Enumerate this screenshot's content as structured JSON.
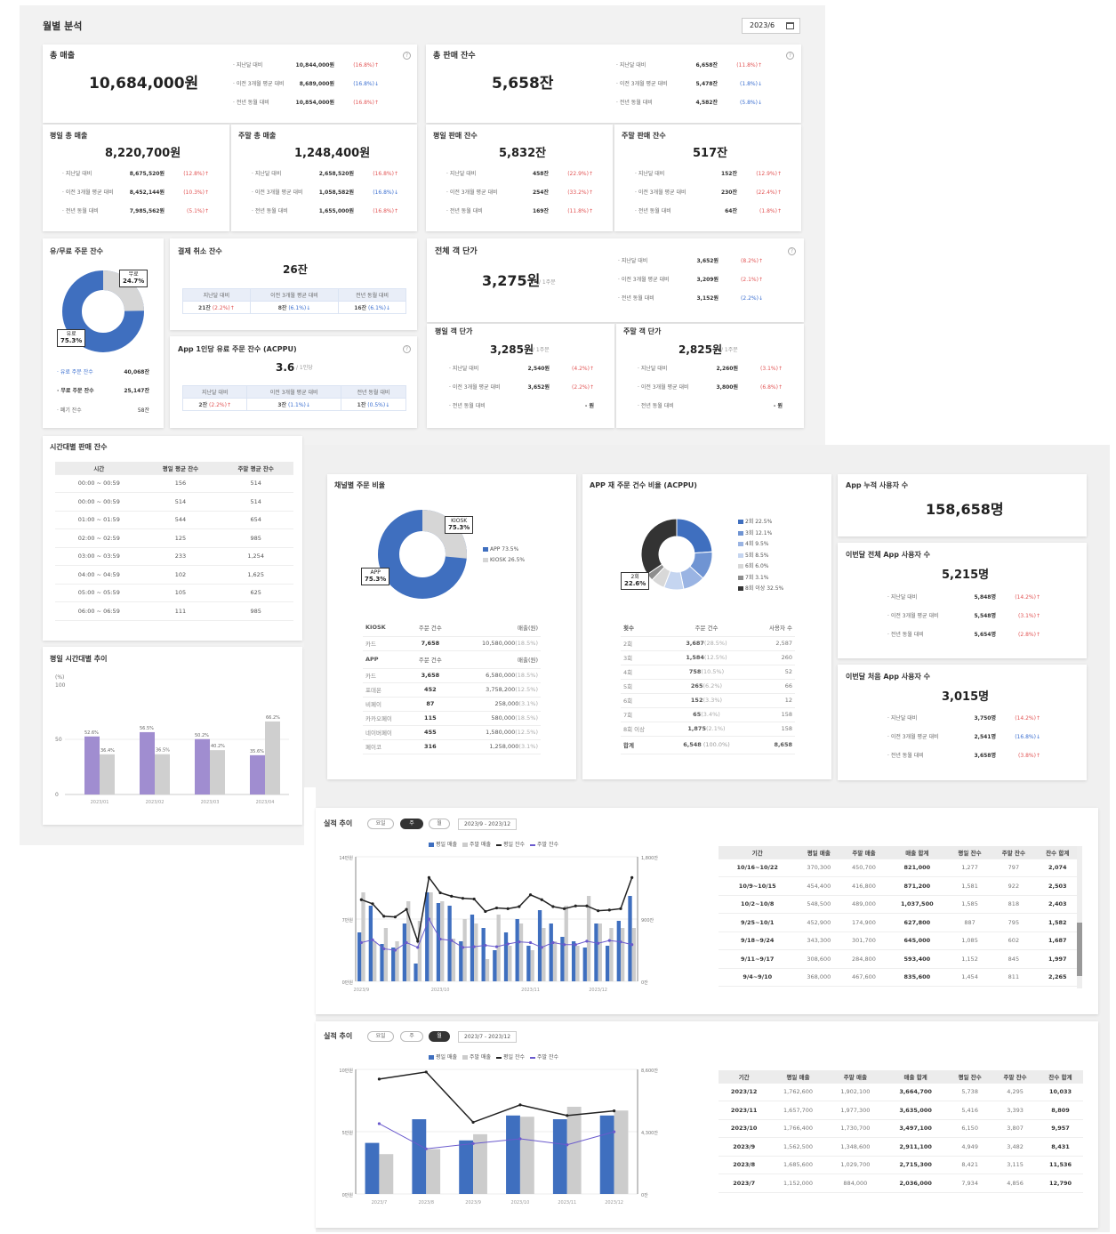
{
  "header": {
    "title": "월별 분석",
    "month": "2023/6"
  },
  "revenue": {
    "title": "총 매출",
    "value": "10,684,000원",
    "compare": [
      {
        "label": "· 지난달 대비",
        "value": "10,844,000원",
        "pct": "(16.8%)↑",
        "dir": "up"
      },
      {
        "label": "· 이전 3개월 평균 대비",
        "value": "8,689,000원",
        "pct": "(16.8%)↓",
        "dir": "down"
      },
      {
        "label": "· 전년 동월 대비",
        "value": "10,854,000원",
        "pct": "(16.8%)↑",
        "dir": "up"
      }
    ],
    "weekday": {
      "title": "평일 총 매출",
      "value": "8,220,700원",
      "compare": [
        {
          "label": "· 지난달 대비",
          "value": "8,675,520원",
          "pct": "(12.8%)↑",
          "dir": "up"
        },
        {
          "label": "· 이전 3개월 평균 대비",
          "value": "8,452,144원",
          "pct": "(10.3%)↑",
          "dir": "up"
        },
        {
          "label": "· 전년 동월 대비",
          "value": "7,985,562원",
          "pct": "(5.1%)↑",
          "dir": "up"
        }
      ]
    },
    "weekend": {
      "title": "주말 총 매출",
      "value": "1,248,400원",
      "compare": [
        {
          "label": "· 지난달 대비",
          "value": "2,658,520원",
          "pct": "(16.8%)↑",
          "dir": "up"
        },
        {
          "label": "· 이전 3개월 평균 대비",
          "value": "1,058,582원",
          "pct": "(16.8%)↓",
          "dir": "down"
        },
        {
          "label": "· 전년 동월 대비",
          "value": "1,655,000원",
          "pct": "(16.8%)↑",
          "dir": "up"
        }
      ]
    }
  },
  "sales": {
    "title": "총 판매 잔수",
    "value": "5,658잔",
    "compare": [
      {
        "label": "· 지난달 대비",
        "value": "6,658잔",
        "pct": "(11.8%)↑",
        "dir": "up"
      },
      {
        "label": "· 이전 3개월 평균 대비",
        "value": "5,478잔",
        "pct": "(1.8%)↓",
        "dir": "down"
      },
      {
        "label": "· 전년 동월 대비",
        "value": "4,582잔",
        "pct": "(5.8%)↓",
        "dir": "down"
      }
    ],
    "weekday": {
      "title": "평일 판매 잔수",
      "value": "5,832잔",
      "compare": [
        {
          "label": "· 지난달 대비",
          "value": "458잔",
          "pct": "(22.9%)↑",
          "dir": "up"
        },
        {
          "label": "· 이전 3개월 평균 대비",
          "value": "254잔",
          "pct": "(33.2%)↑",
          "dir": "up"
        },
        {
          "label": "· 전년 동월 대비",
          "value": "169잔",
          "pct": "(11.8%)↑",
          "dir": "up"
        }
      ]
    },
    "weekend": {
      "title": "주말 판매 잔수",
      "value": "517잔",
      "compare": [
        {
          "label": "· 지난달 대비",
          "value": "152잔",
          "pct": "(12.9%)↑",
          "dir": "up"
        },
        {
          "label": "· 이전 3개월 평균 대비",
          "value": "230잔",
          "pct": "(22.4%)↑",
          "dir": "up"
        },
        {
          "label": "· 전년 동월 대비",
          "value": "64잔",
          "pct": "(1.8%)↑",
          "dir": "up"
        }
      ]
    }
  },
  "paid": {
    "title": "유/무료 주문 잔수",
    "free_label": "무료",
    "free_pct": "24.7%",
    "paid_label": "유료",
    "paid_pct": "75.3%",
    "free_share": 24.7,
    "rows": [
      {
        "label": "· 유료 주문 잔수",
        "value": "40,068잔"
      },
      {
        "label": "· 무료 주문 잔수",
        "value": "25,147잔"
      },
      {
        "label": "· 폐기 잔수",
        "value": "58잔"
      }
    ]
  },
  "cancel": {
    "title": "결제 취소 잔수",
    "value": "26잔",
    "headers": [
      "지난달 대비",
      "이전 3개월 평균 대비",
      "전년 동월 대비"
    ],
    "cells": [
      {
        "v": "21잔",
        "p": "(2.2%)↑",
        "dir": "up"
      },
      {
        "v": "8잔",
        "p": "(6.1%)↓",
        "dir": "down"
      },
      {
        "v": "16잔",
        "p": "(6.1%)↓",
        "dir": "down"
      }
    ]
  },
  "acppu": {
    "title": "App 1인당 유료 주문 잔수 (ACPPU)",
    "value": "3.6",
    "unit": "/ 1인당",
    "headers": [
      "지난달 대비",
      "이전 3개월 평균 대비",
      "전년 동월 대비"
    ],
    "cells": [
      {
        "v": "2잔",
        "p": "(2.2%)↑",
        "dir": "up"
      },
      {
        "v": "3잔",
        "p": "(1.1%)↓",
        "dir": "down"
      },
      {
        "v": "1잔",
        "p": "(0.5%)↓",
        "dir": "down"
      }
    ]
  },
  "price": {
    "title": "전체 객 단가",
    "value": "3,275원",
    "unit": "/ 1주문",
    "compare": [
      {
        "label": "· 지난달 대비",
        "value": "3,652원",
        "pct": "(8.2%)↑",
        "dir": "up"
      },
      {
        "label": "· 이전 3개월 평균 대비",
        "value": "3,209원",
        "pct": "(2.1%)↑",
        "dir": "up"
      },
      {
        "label": "· 전년 동월 대비",
        "value": "3,152원",
        "pct": "(2.2%)↓",
        "dir": "down"
      }
    ],
    "weekday": {
      "title": "평일 객 단가",
      "value": "3,285원",
      "unit": "/ 1주문",
      "compare": [
        {
          "label": "· 지난달 대비",
          "value": "2,540원",
          "pct": "(4.2%)↑",
          "dir": "up"
        },
        {
          "label": "· 이전 3개월 평균 대비",
          "value": "3,652원",
          "pct": "(2.2%)↑",
          "dir": "up"
        },
        {
          "label": "· 전년 동월 대비",
          "value": "- 원",
          "pct": "",
          "dir": "none"
        }
      ]
    },
    "weekend": {
      "title": "주말 객 단가",
      "value": "2,825원",
      "unit": "/ 1주문",
      "compare": [
        {
          "label": "· 지난달 대비",
          "value": "2,260원",
          "pct": "(3.1%)↑",
          "dir": "up"
        },
        {
          "label": "· 이전 3개월 평균 대비",
          "value": "3,800원",
          "pct": "(6.8%)↑",
          "dir": "up"
        },
        {
          "label": "· 전년 동월 대비",
          "value": "- 원",
          "pct": "",
          "dir": "none"
        }
      ]
    }
  },
  "hourly": {
    "title": "시간대별 판매 잔수",
    "headers": [
      "시간",
      "평일 평균 잔수",
      "주말 평균 잔수"
    ],
    "rows": [
      [
        "00:00 ~ 00:59",
        "156",
        "514"
      ],
      [
        "00:00 ~ 00:59",
        "514",
        "514"
      ],
      [
        "01:00 ~ 01:59",
        "544",
        "654"
      ],
      [
        "02:00 ~ 02:59",
        "125",
        "985"
      ],
      [
        "03:00 ~ 03:59",
        "233",
        "1,254"
      ],
      [
        "04:00 ~ 04:59",
        "102",
        "1,625"
      ],
      [
        "05:00 ~ 05:59",
        "105",
        "625"
      ],
      [
        "06:00 ~ 06:59",
        "111",
        "985"
      ]
    ]
  },
  "weekday_trend": {
    "title": "평일 시간대별 추이",
    "yunit": "(%)",
    "ymax": "100",
    "ymid": "50",
    "yzero": "0",
    "categories": [
      "2023/01",
      "2023/02",
      "2023/03",
      "2023/04"
    ],
    "a": [
      52.6,
      56.5,
      50.2,
      35.6
    ],
    "b": [
      36.4,
      36.5,
      40.2,
      66.2
    ],
    "a_labels": [
      "52.6%",
      "56.5%",
      "50.2%",
      "35.6%"
    ],
    "b_labels": [
      "36.4%",
      "36.5%",
      "40.2%",
      "66.2%"
    ]
  },
  "channel": {
    "title": "채널별 주문 비율",
    "kiosk_label": "KIOSK",
    "kiosk_pct": "75.3%",
    "app_label": "APP",
    "app_pct": "75.3%",
    "legend_app": "APP 73.5%",
    "legend_kiosk": "KIOSK 26.5%",
    "app_share": 73.5,
    "kiosk_head": [
      "KIOSK",
      "주문 건수",
      "매출(원)"
    ],
    "kiosk_rows": [
      [
        "카드",
        "7,658",
        "10,580,000",
        "(18.5%)"
      ]
    ],
    "app_head": [
      "APP",
      "주문 건수",
      "매출(원)"
    ],
    "app_rows": [
      [
        "카드",
        "3,658",
        "6,580,000",
        "(18.5%)"
      ],
      [
        "포데온",
        "452",
        "3,758,200",
        "(12.5%)"
      ],
      [
        "비페이",
        "87",
        "258,000",
        "(3.1%)"
      ],
      [
        "카카오페이",
        "115",
        "580,000",
        "(18.5%)"
      ],
      [
        "네이버페이",
        "455",
        "1,580,000",
        "(12.5%)"
      ],
      [
        "페이코",
        "316",
        "1,258,000",
        "(3.1%)"
      ]
    ]
  },
  "reorder": {
    "title": "APP 재 주문 건수 비율 (ACPPU)",
    "callout_label": "2회",
    "callout_pct": "22.6%",
    "legend": [
      {
        "label": "2회 22.5%",
        "color": "#3f6fbf",
        "share": 22.5
      },
      {
        "label": "3회 12.1%",
        "color": "#6f94d3",
        "share": 12.1
      },
      {
        "label": "4회 9.5%",
        "color": "#9ab4e3",
        "share": 9.5
      },
      {
        "label": "5회 8.5%",
        "color": "#c5d5f0",
        "share": 8.5
      },
      {
        "label": "6회 6.0%",
        "color": "#d8d8d8",
        "share": 6.0
      },
      {
        "label": "7회 3.1%",
        "color": "#8e8e8e",
        "share": 3.1
      },
      {
        "label": "8회 이상 32.5%",
        "color": "#333333",
        "share": 32.5
      }
    ],
    "head": [
      "횟수",
      "주문 건수",
      "사용자 수"
    ],
    "rows": [
      [
        "2회",
        "3,687",
        "(28.5%)",
        "2,587"
      ],
      [
        "3회",
        "1,584",
        "(12.5%)",
        "260"
      ],
      [
        "4회",
        "758",
        "(10.5%)",
        "52"
      ],
      [
        "5회",
        "265",
        "(6.2%)",
        "66"
      ],
      [
        "6회",
        "152",
        "(3.3%)",
        "12"
      ],
      [
        "7회",
        "65",
        "(3.4%)",
        "158"
      ],
      [
        "8회 이상",
        "1,875",
        "(2.1%)",
        "158"
      ]
    ],
    "total": [
      "합계",
      "6,548",
      "(100.0%)",
      "8,658"
    ]
  },
  "app_users": {
    "title": "App 누적 사용자 수",
    "value": "158,658명"
  },
  "app_total": {
    "title": "이번달 전체 App 사용자 수",
    "value": "5,215명",
    "compare": [
      {
        "label": "· 지난달 대비",
        "value": "5,848명",
        "pct": "(14.2%)↑",
        "dir": "up"
      },
      {
        "label": "· 이전 3개월 평균 대비",
        "value": "5,548명",
        "pct": "(3.1%)↑",
        "dir": "up"
      },
      {
        "label": "· 전년 동월 대비",
        "value": "5,654명",
        "pct": "(2.8%)↑",
        "dir": "up"
      }
    ]
  },
  "app_first": {
    "title": "이번달 처음 App 사용자 수",
    "value": "3,015명",
    "compare": [
      {
        "label": "· 지난달 대비",
        "value": "3,750명",
        "pct": "(14.2%)↑",
        "dir": "up"
      },
      {
        "label": "· 이전 3개월 평균 대비",
        "value": "2,541명",
        "pct": "(16.8%)↓",
        "dir": "down"
      },
      {
        "label": "· 전년 동월 대비",
        "value": "3,658명",
        "pct": "(3.8%)↑",
        "dir": "up"
      }
    ]
  },
  "perf_week": {
    "title": "실적 추이",
    "tabs": [
      "요일",
      "주",
      "월"
    ],
    "active": 1,
    "range": "2023/9 - 2023/12",
    "legend": [
      "평일 매출",
      "주말 매출",
      "평일 잔수",
      "주말 잔수"
    ],
    "y_left": [
      "14만원",
      "7만원",
      "0만원"
    ],
    "y_right": [
      "1,800잔",
      "900잔",
      "0잔"
    ],
    "x_labels": [
      "2023/9",
      "2023/10",
      "2023/11",
      "2023/12"
    ],
    "table_head": [
      "기간",
      "평일 매출",
      "주말 매출",
      "매출 합계",
      "평일 잔수",
      "주말 잔수",
      "잔수 합계"
    ],
    "table_rows": [
      [
        "10/16~10/22",
        "370,300",
        "450,700",
        "821,000",
        "1,277",
        "797",
        "2,074"
      ],
      [
        "10/9~10/15",
        "454,400",
        "416,800",
        "871,200",
        "1,581",
        "922",
        "2,503"
      ],
      [
        "10/2~10/8",
        "548,500",
        "489,000",
        "1,037,500",
        "1,585",
        "818",
        "2,403"
      ],
      [
        "9/25~10/1",
        "452,900",
        "174,900",
        "627,800",
        "887",
        "795",
        "1,582"
      ],
      [
        "9/18~9/24",
        "343,300",
        "301,700",
        "645,000",
        "1,085",
        "602",
        "1,687"
      ],
      [
        "9/11~9/17",
        "308,600",
        "284,800",
        "593,400",
        "1,152",
        "845",
        "1,997"
      ],
      [
        "9/4~9/10",
        "368,000",
        "467,600",
        "835,600",
        "1,454",
        "811",
        "2,265"
      ]
    ]
  },
  "perf_month": {
    "title": "실적 추이",
    "tabs": [
      "요일",
      "주",
      "월"
    ],
    "active": 2,
    "range": "2023/7 - 2023/12",
    "legend": [
      "평일 매출",
      "주말 매출",
      "평일 잔수",
      "주말 잔수"
    ],
    "y_left": [
      "10만원",
      "5만원",
      "0만원"
    ],
    "y_right": [
      "8,600잔",
      "4,300잔",
      "0잔"
    ],
    "x_labels": [
      "2023/7",
      "2023/8",
      "2023/9",
      "2023/10",
      "2023/11",
      "2023/12"
    ],
    "table_head": [
      "기간",
      "평일 매출",
      "주말 매출",
      "매출 합계",
      "평일 잔수",
      "주말 잔수",
      "잔수 합계"
    ],
    "table_rows": [
      [
        "2023/12",
        "1,762,600",
        "1,902,100",
        "3,664,700",
        "5,738",
        "4,295",
        "10,033"
      ],
      [
        "2023/11",
        "1,657,700",
        "1,977,300",
        "3,635,000",
        "5,416",
        "3,393",
        "8,809"
      ],
      [
        "2023/10",
        "1,766,400",
        "1,730,700",
        "3,497,100",
        "6,150",
        "3,807",
        "9,957"
      ],
      [
        "2023/9",
        "1,562,500",
        "1,348,600",
        "2,911,100",
        "4,949",
        "3,482",
        "8,431"
      ],
      [
        "2023/8",
        "1,685,600",
        "1,029,700",
        "2,715,300",
        "8,421",
        "3,115",
        "11,536"
      ],
      [
        "2023/7",
        "1,152,000",
        "884,000",
        "2,036,000",
        "7,934",
        "4,856",
        "12,790"
      ]
    ]
  },
  "chart_data": [
    {
      "type": "bar",
      "title": "평일 시간대별 추이",
      "ylabel": "(%)",
      "ylim": [
        0,
        100
      ],
      "categories": [
        "2023/01",
        "2023/02",
        "2023/03",
        "2023/04"
      ],
      "series": [
        {
          "values": [
            52.6,
            56.5,
            50.2,
            35.6
          ]
        },
        {
          "values": [
            36.4,
            36.5,
            40.2,
            66.2
          ]
        }
      ]
    },
    {
      "type": "bar",
      "title": "실적 추이",
      "ylim": [
        0,
        14
      ],
      "y2lim": [
        0,
        1800
      ],
      "series": [
        {
          "name": "평일 매출",
          "values": [
            5.5,
            8.5,
            4.2,
            3.8,
            6.5,
            2.0,
            10,
            8.8,
            8.5,
            4.5,
            7.5,
            6.0,
            3.5,
            5.5,
            7.0,
            4.0,
            8.0,
            6.5,
            5.0,
            4.5,
            3.8,
            6.5,
            4.0,
            6.8,
            9.6
          ]
        },
        {
          "name": "주말 매출",
          "values": [
            10,
            4.5,
            6.0,
            4.5,
            9.0,
            6.8,
            10,
            9.0,
            4.8,
            7.0,
            6.5,
            2.5,
            7.5,
            4.0,
            6.5,
            3.5,
            6.0,
            4.5,
            8.5,
            4.0,
            9.6,
            6.5,
            6.0,
            6.0,
            6.0
          ]
        },
        {
          "name": "평일 잔수",
          "values": [
            1180,
            1120,
            940,
            930,
            1040,
            580,
            1500,
            1280,
            1230,
            1200,
            1190,
            1010,
            1060,
            1050,
            1080,
            1250,
            1180,
            1080,
            1050,
            1090,
            1090,
            1020,
            1030,
            1050,
            1500
          ]
        },
        {
          "name": "주말 잔수",
          "values": [
            560,
            600,
            470,
            450,
            560,
            490,
            900,
            610,
            590,
            490,
            500,
            520,
            500,
            540,
            570,
            560,
            490,
            560,
            530,
            530,
            580,
            550,
            590,
            570,
            530
          ]
        }
      ]
    },
    {
      "type": "bar",
      "title": "실적 추이",
      "ylim": [
        0,
        10
      ],
      "y2lim": [
        0,
        8600
      ],
      "categories": [
        "2023/7",
        "2023/8",
        "2023/9",
        "2023/10",
        "2023/11",
        "2023/12"
      ],
      "series": [
        {
          "name": "평일 매출",
          "values": [
            4.1,
            6.0,
            4.3,
            6.3,
            6.0,
            6.3
          ]
        },
        {
          "name": "주말 매출",
          "values": [
            3.2,
            3.6,
            4.8,
            6.2,
            7.0,
            6.7
          ]
        },
        {
          "name": "평일 잔수",
          "values": [
            7934,
            8421,
            4949,
            6150,
            5416,
            5738
          ]
        },
        {
          "name": "주말 잔수",
          "values": [
            4856,
            3115,
            3482,
            3807,
            3393,
            4295
          ]
        }
      ]
    }
  ]
}
